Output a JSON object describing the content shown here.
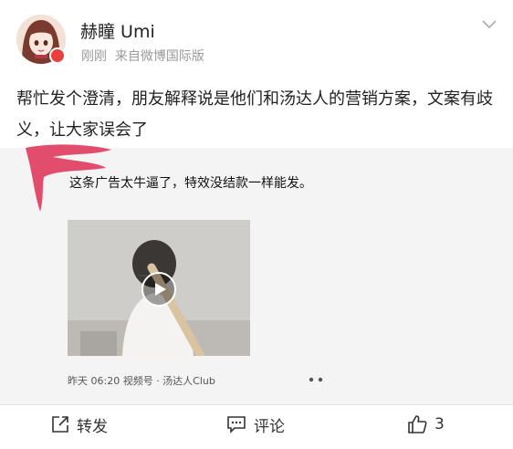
{
  "post": {
    "username": "赫瞳 Umi",
    "time": "刚刚",
    "source_prefix": "来自",
    "source_client": "微博国际版",
    "text": "帮忙发个澄清，朋友解释说是他们和汤达人的营销方案，文案有歧义，让大家误会了"
  },
  "quoted_post": {
    "text": "这条广告太牛逼了，特效没结款一样能发。",
    "video_caption": "昨天 06:20  视频号 · 汤达人Club"
  },
  "actions": {
    "repost_label": "转发",
    "comment_label": "评论",
    "like_count": "3"
  },
  "colors": {
    "accent_red": "#e8413b",
    "scribble_red": "#e03a5e",
    "meta_gray": "#9a9a9a",
    "quote_bg": "#f4f4f4"
  },
  "icons": {
    "repost": "share-square-icon",
    "comment": "comment-bubble-icon",
    "like": "thumbs-up-icon",
    "menu": "chevron-down-icon",
    "play": "play-icon",
    "more": "more-dots-icon"
  }
}
